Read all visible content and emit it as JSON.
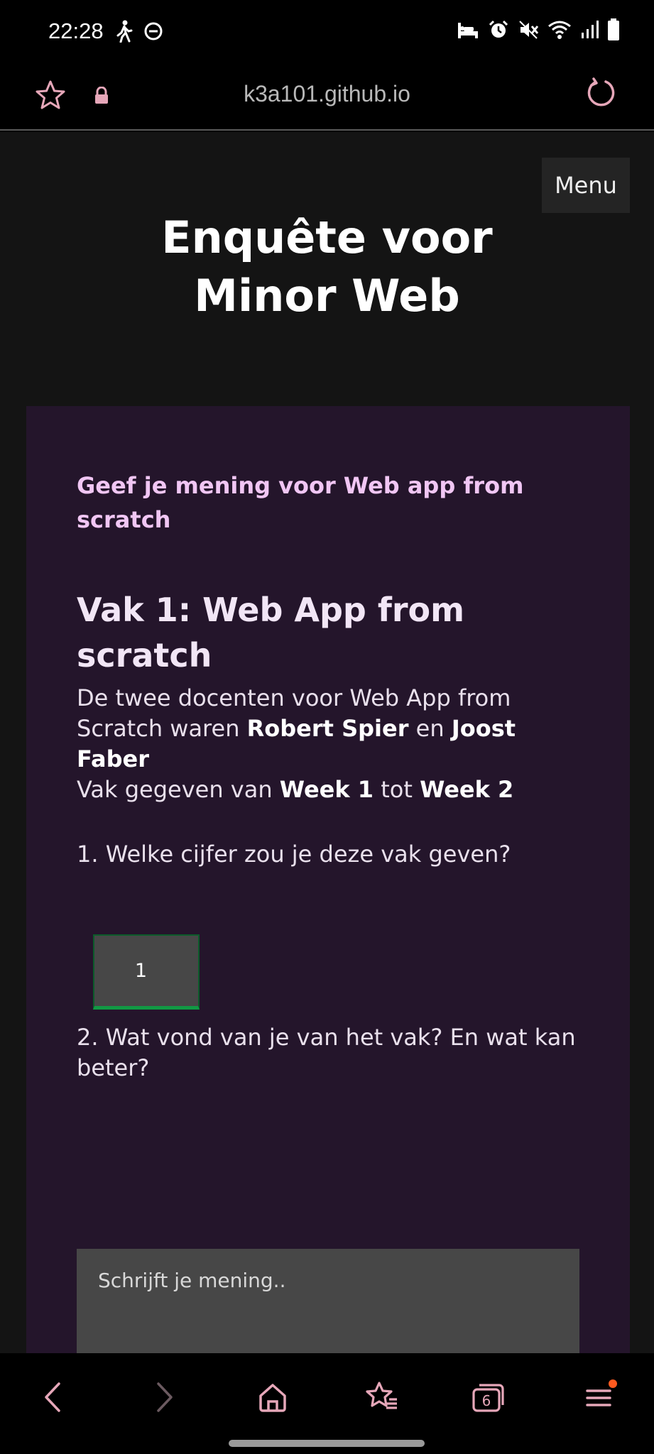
{
  "status_bar": {
    "time": "22:28"
  },
  "browser": {
    "url": "k3a101.github.io",
    "tab_count": "6"
  },
  "page": {
    "menu_label": "Menu",
    "title_line1": "Enquête voor",
    "title_line2": "Minor Web"
  },
  "card": {
    "subtitle": "Geef je mening voor Web app from scratch",
    "course_title": "Vak 1: Web App from scratch",
    "desc_prefix": "De twee docenten voor Web App from Scratch waren ",
    "teacher1": "Robert Spier",
    "desc_and": " en ",
    "teacher2": "Joost Faber",
    "period_prefix": "Vak gegeven van ",
    "week_start": "Week 1",
    "period_mid": " tot ",
    "week_end": "Week 2",
    "question1": "1. Welke cijfer zou je deze vak geven?",
    "grade_value": "1",
    "question2": "2. Wat vond van je van het vak? En wat kan beter?",
    "opinion_placeholder": "Schrijft je mening.."
  },
  "colors": {
    "accent_pink": "#e6a7b9",
    "card_bg": "#24152b",
    "subtitle_color": "#f1c6f4",
    "input_focus_green": "#119944",
    "notification_dot": "#ff5a1f"
  },
  "icons": [
    "walking-icon",
    "dnd-icon",
    "sleep-icon",
    "alarm-icon",
    "mute-icon",
    "wifi-icon",
    "signal-icon",
    "battery-icon",
    "star-icon",
    "lock-icon",
    "reload-icon",
    "back-icon",
    "forward-icon",
    "home-icon",
    "bookmarks-icon",
    "tabs-icon",
    "menu-icon"
  ]
}
